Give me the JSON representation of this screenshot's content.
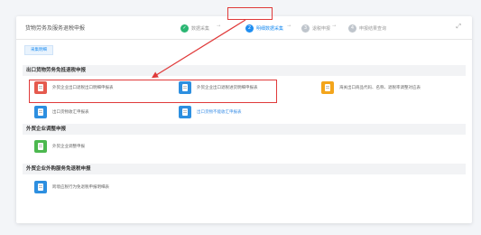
{
  "header": {
    "title": "货物劳务及服务退税申报",
    "steps": [
      {
        "num": "✓",
        "label": "数据采集",
        "state": "done"
      },
      {
        "num": "2",
        "label": "明细数据采集",
        "state": "active"
      },
      {
        "num": "3",
        "label": "退税申报",
        "state": "todo"
      },
      {
        "num": "4",
        "label": "申报结果查询",
        "state": "todo"
      }
    ],
    "expand_icon": "expand-icon"
  },
  "tab": {
    "label": "采集明细"
  },
  "sections": [
    {
      "title": "出口货物劳务免抵退税申报",
      "items": [
        {
          "label": "外贸企业出口退税出口明细申报表",
          "icon": "export-doc-icon",
          "color": "#e55a4e"
        },
        {
          "label": "外贸企业出口退税进货明细申报表",
          "icon": "import-doc-icon",
          "color": "#2d8fe0"
        },
        {
          "label": "海关出口商品代码、名称、退税率调整对应表",
          "icon": "table-icon",
          "color": "#f3a51c"
        },
        {
          "label": "出口货物收汇申报表",
          "icon": "receipt-icon",
          "color": "#2d8fe0"
        },
        {
          "label": "出口货物不能收汇申报表",
          "icon": "no-receipt-icon",
          "color": "#2d8fe0"
        }
      ]
    },
    {
      "title": "外贸企业调整申报",
      "items": [
        {
          "label": "外贸企业调整申报",
          "icon": "adjust-doc-icon",
          "color": "#4cb84f"
        }
      ]
    },
    {
      "title": "外贸企业外购服务免退税申报",
      "items": [
        {
          "label": "跨境应税行为免退税申报明细表",
          "icon": "service-doc-icon",
          "color": "#2d8fe0"
        }
      ]
    }
  ],
  "annotations": {
    "highlight_color": "#e03a3a"
  }
}
